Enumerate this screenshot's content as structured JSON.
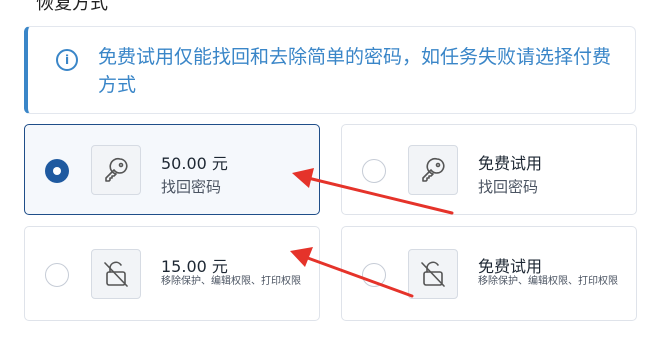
{
  "section_title_cut": "恢复方式",
  "notice": {
    "icon": "info-icon",
    "text": "免费试用仅能找回和去除简单的密码，如任务失败请选择付费方式"
  },
  "options": [
    {
      "price": "50.00 元",
      "desc": "找回密码",
      "icon": "key-icon",
      "selected": true
    },
    {
      "price": "免费试用",
      "desc": "找回密码",
      "icon": "key-icon",
      "selected": false
    },
    {
      "price": "15.00 元",
      "desc": "移除保护、编辑权限、打印权限",
      "icon": "unlock-icon",
      "selected": false
    },
    {
      "price": "免费试用",
      "desc": "移除保护、编辑权限、打印权限",
      "icon": "unlock-icon",
      "selected": false
    }
  ],
  "colors": {
    "accent": "#3a86c8",
    "selected_radio": "#1f5aa0",
    "arrow": "#e5332a"
  }
}
